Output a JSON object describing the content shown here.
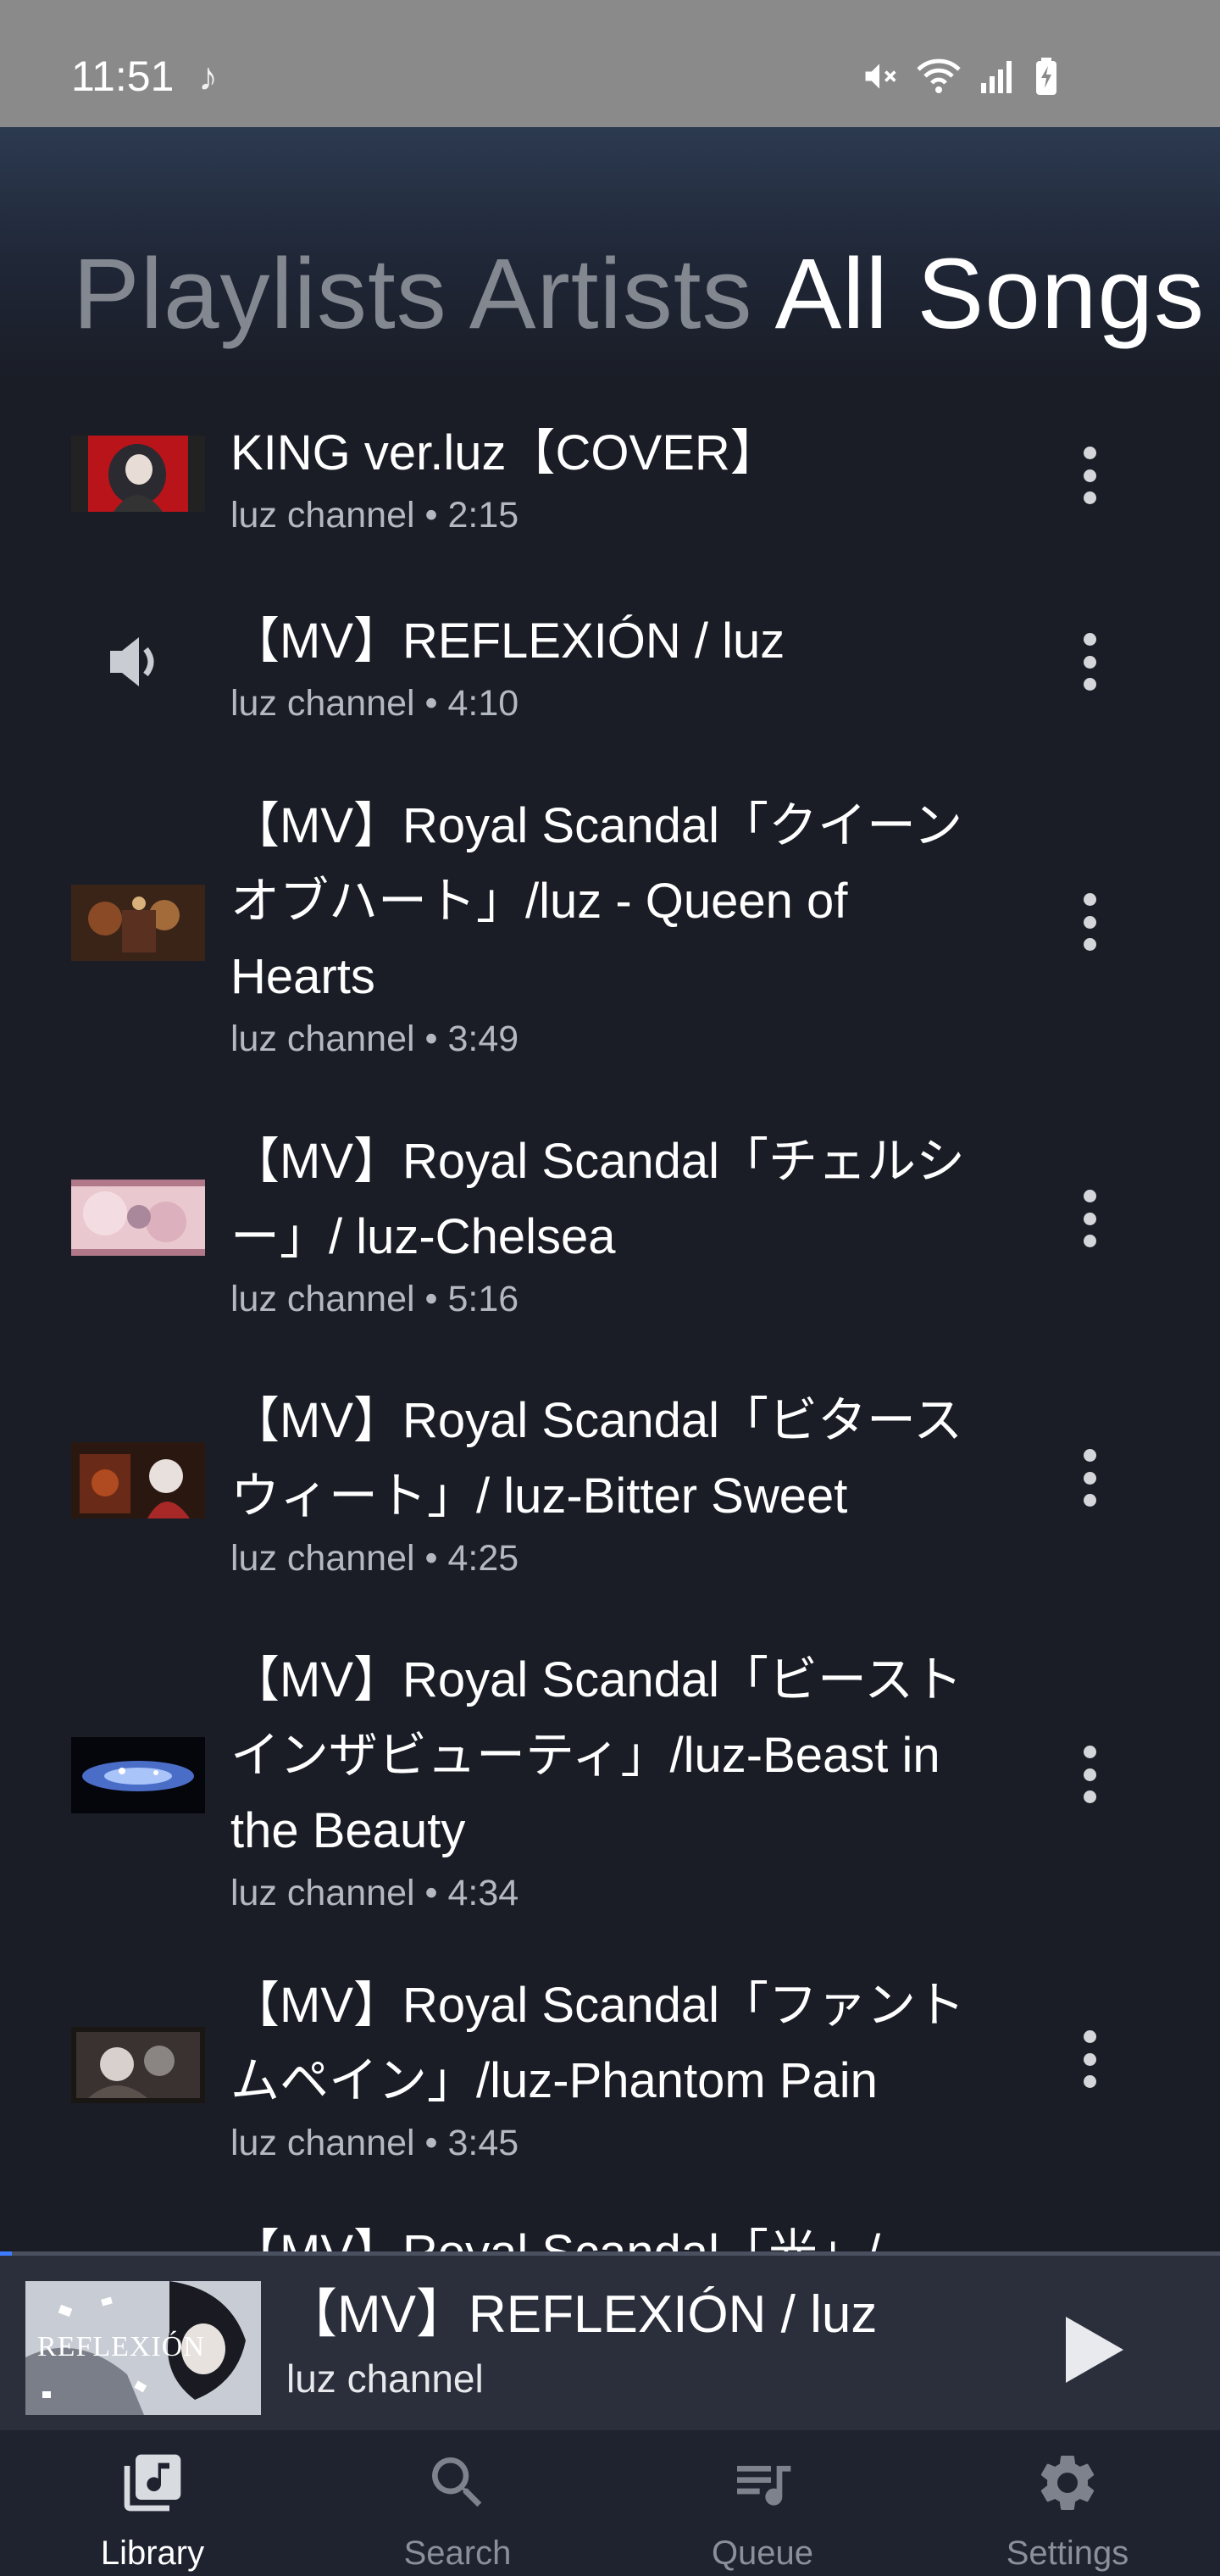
{
  "status_bar": {
    "time": "11:51",
    "icons": [
      "music-note-icon",
      "mute-icon",
      "wifi-icon",
      "signal-icon",
      "battery-charging-icon"
    ]
  },
  "tabs": [
    {
      "label": "Playlists",
      "active": false
    },
    {
      "label": "Artists",
      "active": false
    },
    {
      "label": "All Songs",
      "active": true
    }
  ],
  "songs": [
    {
      "title": "KING ver.luz【COVER】",
      "meta": "luz channel • 2:15",
      "thumb": "king-cover",
      "now_playing": false
    },
    {
      "title": "【MV】REFLEXIÓN / luz",
      "meta": "luz channel • 4:10",
      "thumb": "speaker",
      "now_playing": true
    },
    {
      "title": "【MV】Royal Scandal「クイーンオブハート」/luz - Queen of Hearts",
      "meta": "luz channel • 3:49",
      "thumb": "queen-of-hearts",
      "now_playing": false
    },
    {
      "title": "【MV】Royal Scandal「チェルシー」/ luz-Chelsea",
      "meta": "luz channel • 5:16",
      "thumb": "chelsea",
      "now_playing": false
    },
    {
      "title": "【MV】Royal Scandal「ビタースウィート」/ luz-Bitter Sweet",
      "meta": "luz channel • 4:25",
      "thumb": "bitter-sweet",
      "now_playing": false
    },
    {
      "title": "【MV】Royal Scandal「ビーストインザビューティ」/luz-Beast in the Beauty",
      "meta": "luz channel • 4:34",
      "thumb": "beast-in-the-beauty",
      "now_playing": false
    },
    {
      "title": "【MV】Royal Scandal「ファントムペイン」/luz-Phantom Pain",
      "meta": "luz channel • 3:45",
      "thumb": "phantom-pain",
      "now_playing": false
    },
    {
      "title": "【MV】Royal Scandal「光」/",
      "meta": "",
      "thumb": "",
      "now_playing": false
    }
  ],
  "mini_player": {
    "title": "【MV】REFLEXIÓN / luz",
    "artist": "luz channel",
    "thumb_text": "REFLEXIÓN",
    "progress": 0.01,
    "accent": "#3d7bff"
  },
  "bottom_nav": [
    {
      "label": "Library",
      "icon": "library-music-icon",
      "active": true
    },
    {
      "label": "Search",
      "icon": "search-icon",
      "active": false
    },
    {
      "label": "Queue",
      "icon": "queue-music-icon",
      "active": false
    },
    {
      "label": "Settings",
      "icon": "gear-icon",
      "active": false
    }
  ]
}
